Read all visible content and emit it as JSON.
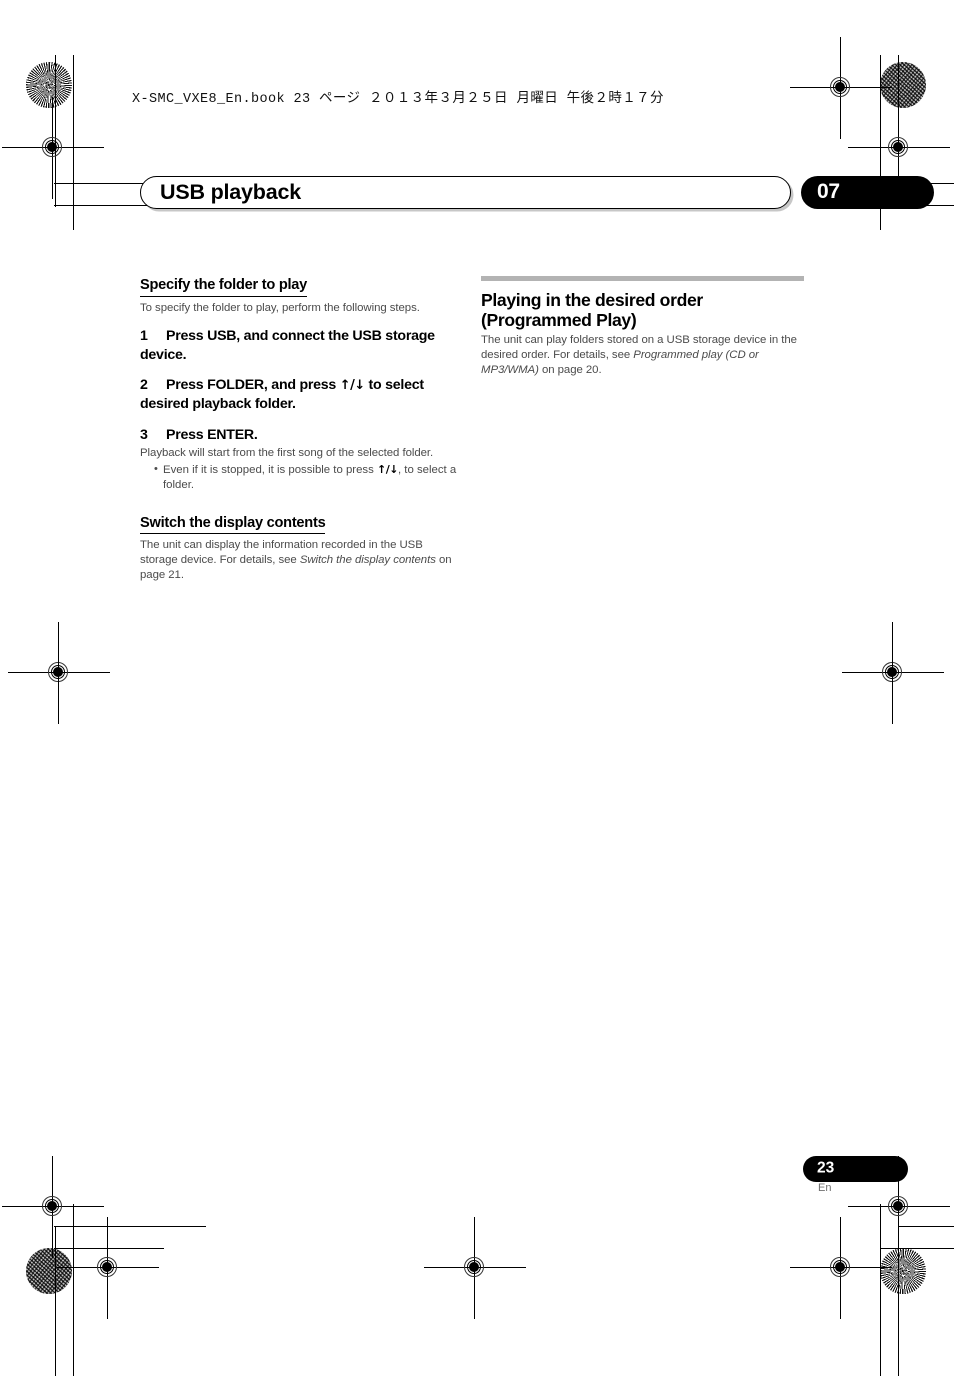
{
  "print_header": {
    "text": "X-SMC_VXE8_En.book   23 ページ   ２０１３年３月２５日   月曜日   午後２時１７分"
  },
  "chapter": {
    "title": "USB playback",
    "number": "07"
  },
  "left_column": {
    "section1": {
      "heading": "Specify the folder to play",
      "intro": "To specify the folder to play, perform the following steps.",
      "steps": [
        {
          "number": "1",
          "text": "Press USB, and connect the USB storage device."
        },
        {
          "number": "2",
          "text_before": "Press FOLDER, and press ",
          "arrows": "↑/↓",
          "text_after": " to select desired playback folder."
        },
        {
          "number": "3",
          "text": "Press ENTER."
        }
      ],
      "step3_note": "Playback will start from the first song of the selected folder.",
      "bullet": {
        "before": "Even if it is stopped, it is possible to press ",
        "arrows": "↑/↓",
        "after": ", to select a folder."
      }
    },
    "section2": {
      "heading": "Switch the display contents",
      "body_part1": "The unit can display the information recorded in the USB storage device. For details, see ",
      "body_italic": "Switch the display contents",
      "body_part2": " on page 21."
    }
  },
  "right_column": {
    "section1": {
      "heading_line1": "Playing in the desired order",
      "heading_line2": "(Programmed Play)",
      "body_part1": "The unit can play folders stored on a USB storage device in the desired order. For details, see ",
      "body_italic": "Programmed play (CD or MP3/WMA)",
      "body_part2": " on page 20."
    }
  },
  "footer": {
    "page_number": "23",
    "language_code": "En"
  },
  "colors": {
    "gray_rule": "#b3b3b3",
    "body_text": "#4b4b4b",
    "badge_bg": "#000000"
  }
}
